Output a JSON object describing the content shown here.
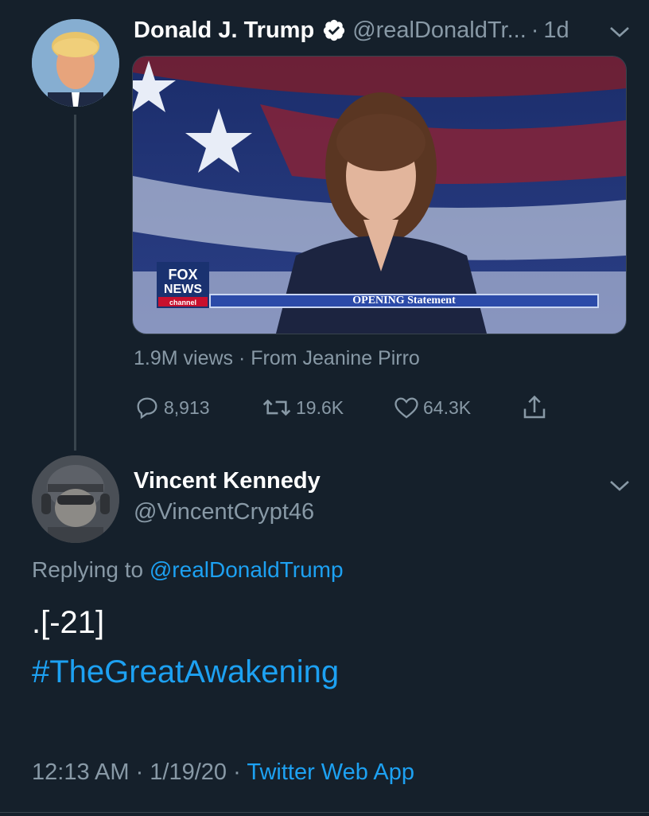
{
  "original_tweet": {
    "author_name": "Donald J. Trump",
    "handle_truncated": "@realDonaldTr...",
    "separator": "·",
    "time": "1d",
    "video": {
      "network_logo_text": [
        "FOX",
        "NEWS",
        "channel"
      ],
      "banner_text": "OPENING Statement"
    },
    "meta": "1.9M views · From Jeanine Pirro",
    "actions": {
      "replies": "8,913",
      "retweets": "19.6K",
      "likes": "64.3K"
    }
  },
  "reply_tweet": {
    "author_name": "Vincent Kennedy",
    "handle": "@VincentCrypt46",
    "replying_prefix": "Replying to",
    "replying_to": "@realDonaldTrump",
    "text_line1": ".[-21]",
    "hashtag": "#TheGreatAwakening",
    "timestamp": "12:13 AM · 1/19/20 ·",
    "source": "Twitter Web App"
  },
  "colors": {
    "background": "#15202b",
    "text_primary": "#ffffff",
    "text_secondary": "#8899a6",
    "link": "#1da1f2",
    "divider": "#38444d"
  }
}
